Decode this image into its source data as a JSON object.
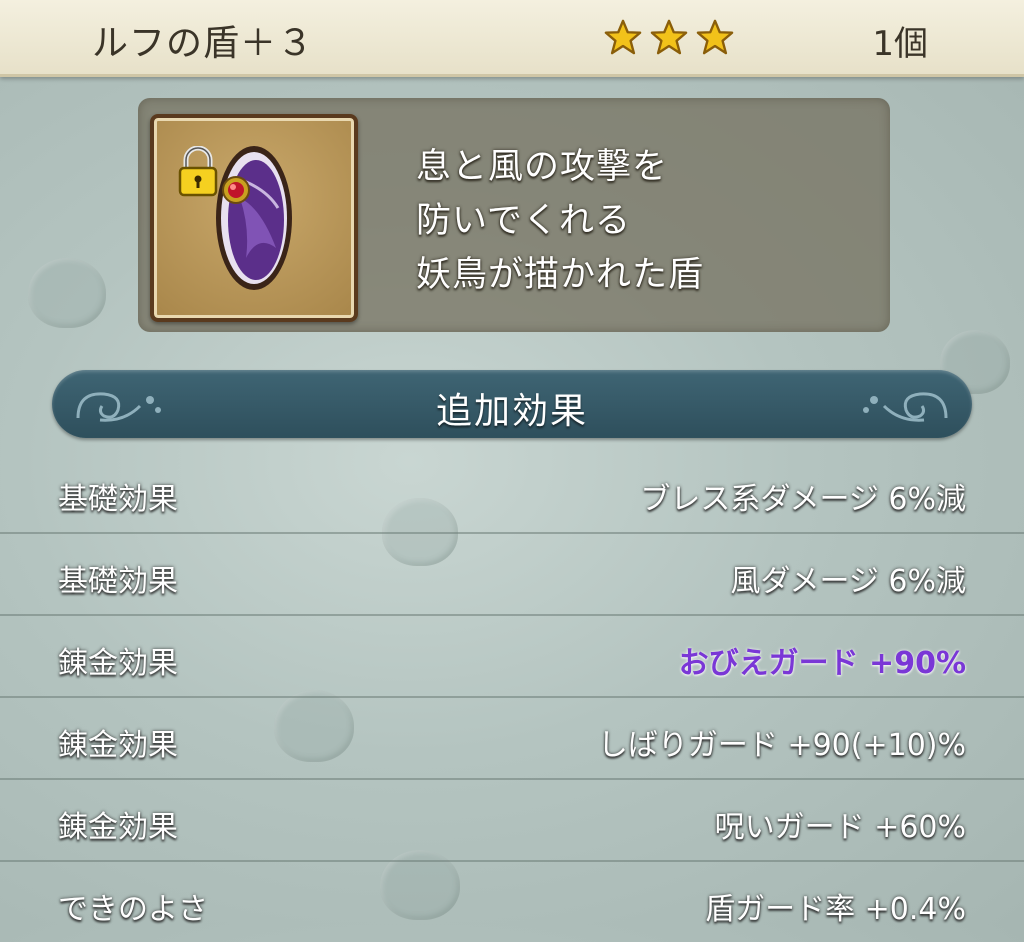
{
  "header": {
    "item_name": "ルフの盾＋３",
    "rarity_stars": 3,
    "star_icon": "star-icon",
    "count": "1個"
  },
  "item": {
    "icon": "shield-icon",
    "locked": true,
    "lock_icon": "lock-icon",
    "description_lines": [
      "息と風の攻撃を",
      "防いでくれる",
      "妖鳥が描かれた盾"
    ]
  },
  "section": {
    "title": "追加効果"
  },
  "effects": [
    {
      "label": "基礎効果",
      "value": "ブレス系ダメージ  6%減",
      "highlight": false
    },
    {
      "label": "基礎効果",
      "value": "風ダメージ  6%減",
      "highlight": false
    },
    {
      "label": "錬金効果",
      "value": "おびえガード  +90%",
      "highlight": true
    },
    {
      "label": "錬金効果",
      "value": "しばりガード  +90(+10)%",
      "highlight": false
    },
    {
      "label": "錬金効果",
      "value": "呪いガード  +60%",
      "highlight": false
    },
    {
      "label": "できのよさ",
      "value": "盾ガード率  +0.4%",
      "highlight": false
    }
  ],
  "colors": {
    "highlight_effect": "#7a37d6",
    "banner": "#345866",
    "header_bg": "#efeada",
    "star": "#f2c21a"
  }
}
